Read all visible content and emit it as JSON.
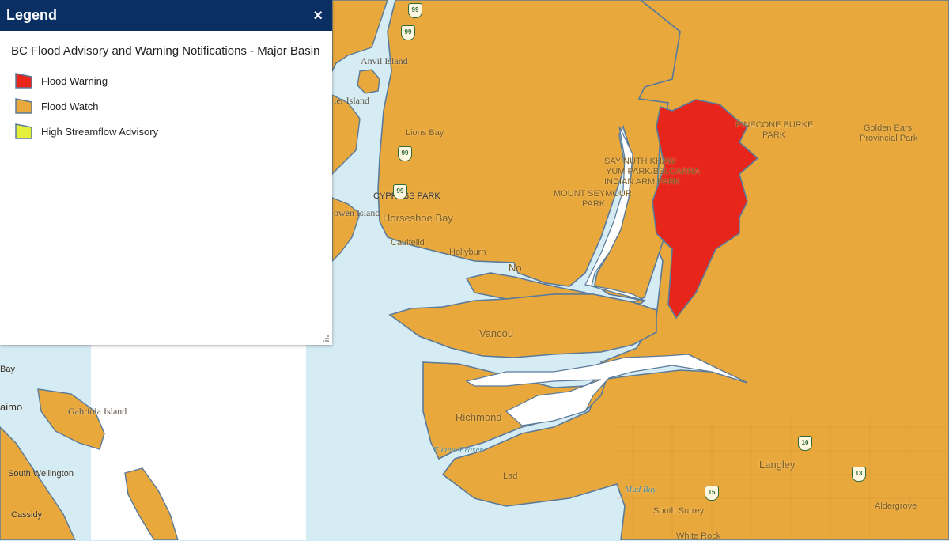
{
  "legend": {
    "title": "Legend",
    "close_label": "×",
    "layer_title": "BC Flood Advisory and Warning Notifications - Major Basin",
    "items": [
      {
        "label": "Flood Warning",
        "color": "#e8251a"
      },
      {
        "label": "Flood Watch",
        "color": "#e9a83c"
      },
      {
        "label": "High Streamflow Advisory",
        "color": "#e6f03a"
      }
    ]
  },
  "map": {
    "water_color": "#d6ecf5",
    "land_color": "#ece6d9",
    "watch_color": "#e9a83c",
    "warning_color": "#e8251a",
    "outline_color": "#5a7a9a",
    "places": {
      "anvil_island": "Anvil Island",
      "bowyer_island": "ier Island",
      "lions_bay": "Lions Bay",
      "bowen_island": "owen Island",
      "cypress_park": "CYPRESS PARK",
      "horseshoe_bay": "Horseshoe Bay",
      "caulfeild": "Caulfeild",
      "hollyburn": "Hollyburn",
      "north_van": "No",
      "say_nuth": "SAY NUTH KHAW",
      "yum_park": "YUM PARK/BELCARRA",
      "indian_arm": "INDIAN ARM PARK",
      "mount_seymour": "MOUNT SEYMOUR",
      "mount_seymour_park": "PARK",
      "pinecone_burke": "PINECONE BURKE",
      "pinecone_park": "PARK",
      "golden_ears": "Golden Ears",
      "golden_ears_park": "Provincial Park",
      "vancouver": "Vancou",
      "richmond": "Richmond",
      "fraser": "Fleuve Fraser",
      "ladner": "Lad",
      "mud_bay": "Mud Bay",
      "south_surrey": "South Surrey",
      "white_rock": "White Rock",
      "langley": "Langley",
      "aldergrove": "Aldergrove",
      "nanaimo_bay": "Bay",
      "nanaimo": "aimo",
      "gabriola": "Gabriola Island",
      "south_wellington": "South Wellington",
      "cassidy": "Cassidy"
    },
    "highways": [
      "99",
      "99",
      "99",
      "99",
      "15",
      "10",
      "13"
    ]
  }
}
